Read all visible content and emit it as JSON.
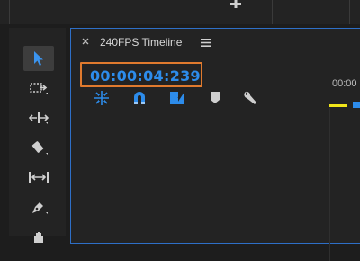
{
  "timeline": {
    "title": "240FPS Timeline",
    "timecode": "00:00:04:239",
    "ruler_label": "00:00"
  },
  "tools": [
    "selection-tool",
    "track-select-forward-tool",
    "ripple-edit-tool",
    "razor-tool",
    "slip-tool",
    "pen-tool",
    "hand-tool"
  ],
  "colors": {
    "accent_blue": "#2d8ceb",
    "highlight_orange": "#e07a2e",
    "work_area_yellow": "#f0e51a",
    "panel_bg": "#232323"
  }
}
